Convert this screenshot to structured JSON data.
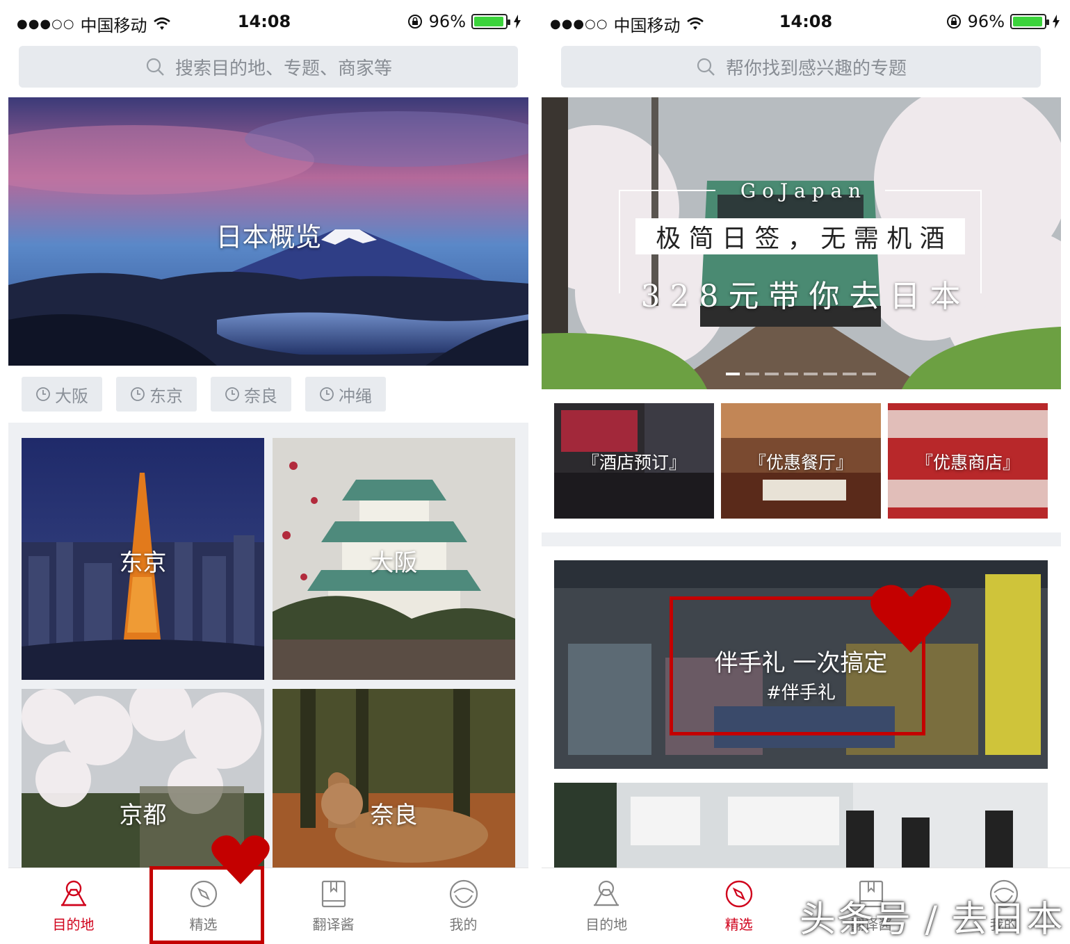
{
  "left": {
    "status": {
      "carrier": "中国移动",
      "time": "14:08",
      "battery": "96%"
    },
    "search": {
      "placeholder": "搜索目的地、专题、商家等"
    },
    "hero": {
      "title": "日本概览"
    },
    "chips": [
      "大阪",
      "东京",
      "奈良",
      "冲绳"
    ],
    "cities": [
      {
        "name": "东京"
      },
      {
        "name": "大阪"
      },
      {
        "name": "京都"
      },
      {
        "name": "奈良"
      }
    ],
    "tabs": [
      {
        "label": "目的地",
        "icon": "mountain-icon",
        "active": true
      },
      {
        "label": "精选",
        "icon": "compass-icon",
        "active": false
      },
      {
        "label": "翻译酱",
        "icon": "book-icon",
        "active": false
      },
      {
        "label": "我的",
        "icon": "face-icon",
        "active": false
      }
    ]
  },
  "right": {
    "status": {
      "carrier": "中国移动",
      "time": "14:08",
      "battery": "96%"
    },
    "search": {
      "placeholder": "帮你找到感兴趣的专题"
    },
    "banner": {
      "top": "G o   J a p a n",
      "line1": "极 简 日 签 ， 无 需 机 酒",
      "line2": "3 2 8 元 带 你 去 日 本"
    },
    "categories": [
      "『酒店预订』",
      "『优惠餐厅』",
      "『优惠商店』"
    ],
    "feature": {
      "title": "伴手礼 一次搞定",
      "tag": "#伴手礼"
    },
    "tabs": [
      {
        "label": "目的地",
        "icon": "mountain-icon",
        "active": false
      },
      {
        "label": "精选",
        "icon": "compass-icon",
        "active": true
      },
      {
        "label": "翻译酱",
        "icon": "book-icon",
        "active": false
      },
      {
        "label": "我的",
        "icon": "face-icon",
        "active": false
      }
    ]
  },
  "watermark": "头条号 / 去日本",
  "colors": {
    "accent": "#d0021b",
    "highlight": "#c40000",
    "battery": "#3cd33c"
  }
}
